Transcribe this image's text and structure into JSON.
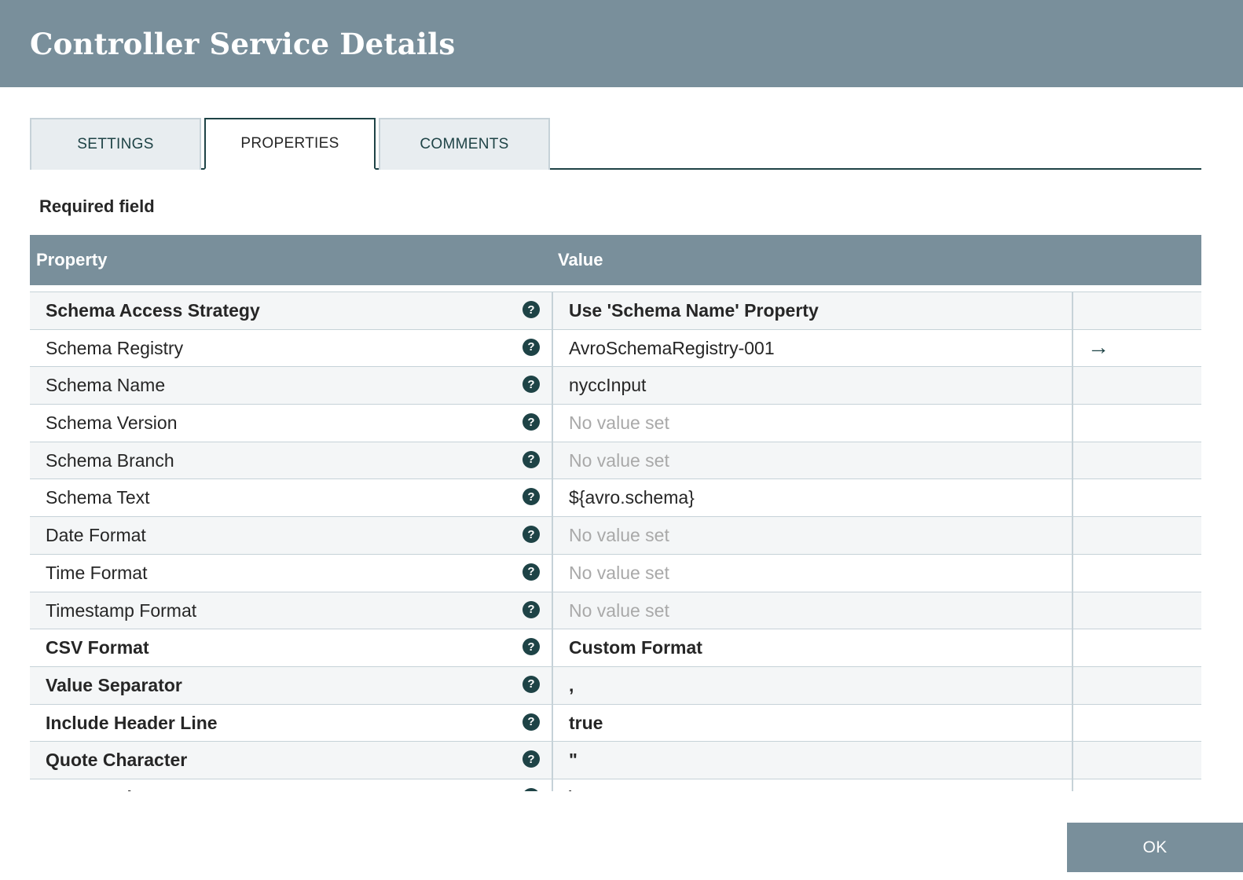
{
  "dialog": {
    "title": "Controller Service Details"
  },
  "tabs": [
    {
      "label": "SETTINGS",
      "active": false
    },
    {
      "label": "PROPERTIES",
      "active": true
    },
    {
      "label": "COMMENTS",
      "active": false
    }
  ],
  "required_label": "Required field",
  "table": {
    "headers": {
      "property": "Property",
      "value": "Value"
    },
    "rows": [
      {
        "name": "Schema Access Strategy",
        "value": "Use 'Schema Name' Property",
        "required": true,
        "unset": false,
        "action": ""
      },
      {
        "name": "Schema Registry",
        "value": "AvroSchemaRegistry-001",
        "required": false,
        "unset": false,
        "action": "→"
      },
      {
        "name": "Schema Name",
        "value": "nyccInput",
        "required": false,
        "unset": false,
        "action": ""
      },
      {
        "name": "Schema Version",
        "value": "No value set",
        "required": false,
        "unset": true,
        "action": ""
      },
      {
        "name": "Schema Branch",
        "value": "No value set",
        "required": false,
        "unset": true,
        "action": ""
      },
      {
        "name": "Schema Text",
        "value": "${avro.schema}",
        "required": false,
        "unset": false,
        "action": ""
      },
      {
        "name": "Date Format",
        "value": "No value set",
        "required": false,
        "unset": true,
        "action": ""
      },
      {
        "name": "Time Format",
        "value": "No value set",
        "required": false,
        "unset": true,
        "action": ""
      },
      {
        "name": "Timestamp Format",
        "value": "No value set",
        "required": false,
        "unset": true,
        "action": ""
      },
      {
        "name": "CSV Format",
        "value": "Custom Format",
        "required": true,
        "unset": false,
        "action": ""
      },
      {
        "name": "Value Separator",
        "value": ",",
        "required": true,
        "unset": false,
        "action": ""
      },
      {
        "name": "Include Header Line",
        "value": "true",
        "required": true,
        "unset": false,
        "action": ""
      },
      {
        "name": "Quote Character",
        "value": "\"",
        "required": true,
        "unset": false,
        "action": ""
      },
      {
        "name": "Escape Character",
        "value": "\\",
        "required": true,
        "unset": false,
        "action": ""
      }
    ]
  },
  "help_icon_glyph": "?",
  "buttons": {
    "ok": "OK"
  },
  "colors": {
    "header": "#798f9b",
    "accent": "#1e4346",
    "unset_text": "#a9a9a9"
  }
}
